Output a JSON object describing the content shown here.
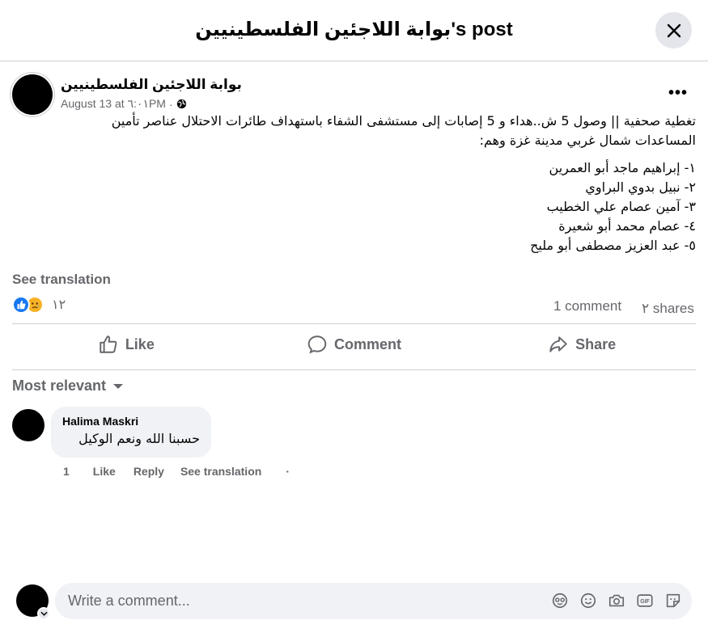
{
  "header": {
    "title": "بوابة اللاجئين الفلسطينيين's post"
  },
  "post": {
    "page_name": "بوابة اللاجئين الفلسطينيين",
    "date": "August 13 at ٦:٠١PM",
    "separator": "·",
    "body_intro_line1": "تغطية صحفية || وصول 5 ش..هداء و 5 إصابات إلى مستشفى الشفاء باستهداف طائرات الاحتلال عناصر تأمين",
    "body_intro_line2": "المساعدات شمال غربي مدينة غزة وهم:",
    "names": [
      "١- إبراهيم ماجد أبو العمرين",
      "٢- نبيل بدوي البراوي",
      "٣- آمين عصام علي الخطيب",
      "٤- عصام محمد أبو شعيرة",
      "٥- عبد العزيز مصطفى أبو مليح"
    ],
    "see_translation": "See translation"
  },
  "stats": {
    "reaction_count": "١٢",
    "comment_count": "1 comment",
    "share_count": "٢ shares"
  },
  "actions": {
    "like": "Like",
    "comment": "Comment",
    "share": "Share"
  },
  "comments_section": {
    "sort_label": "Most relevant",
    "comments": [
      {
        "author": "Halima Maskri",
        "text": "حسبنا الله ونعم الوكيل",
        "age": "1",
        "like": "Like",
        "reply": "Reply",
        "see_translation": "See translation",
        "dot": "·"
      }
    ]
  },
  "composer": {
    "placeholder": "Write a comment..."
  },
  "colors": {
    "brand_blue": "#1877f2",
    "secondary_text": "#65676b",
    "bubble_bg": "#f0f2f5",
    "divider": "#ced0d4"
  },
  "icons": [
    "close-icon",
    "globe-icon",
    "more-options-icon",
    "like-reaction-icon",
    "sad-reaction-icon",
    "thumbs-up-icon",
    "comment-icon",
    "share-icon",
    "dropdown-caret-icon",
    "chevron-down-icon",
    "avatar-sticker-icon",
    "emoji-icon",
    "camera-icon",
    "gif-icon",
    "sticker-icon"
  ]
}
